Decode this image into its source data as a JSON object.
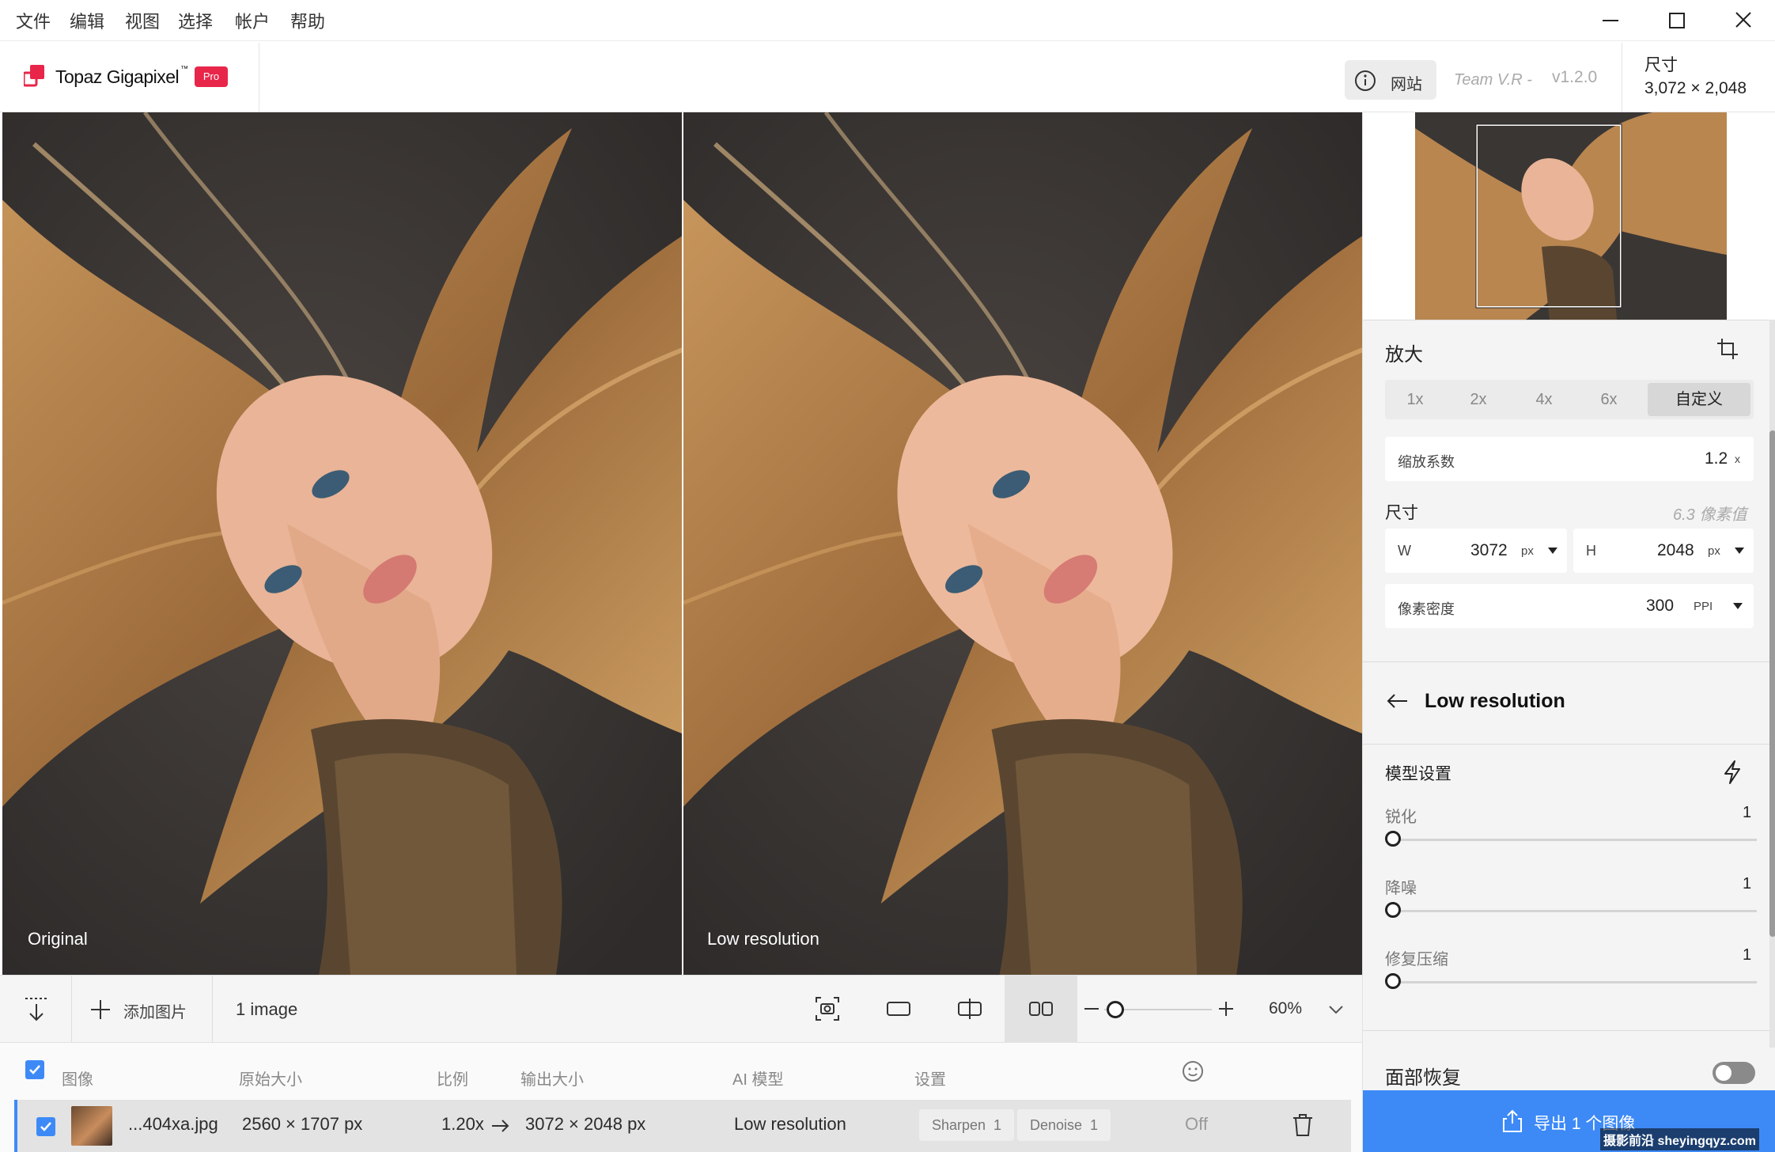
{
  "menu": [
    "文件",
    "编辑",
    "视图",
    "选择",
    "帐户",
    "帮助"
  ],
  "header": {
    "app_name": "Topaz Gigapixel",
    "app_tm": "™",
    "pro_badge": "Pro",
    "website_label": "网站",
    "team": "Team V.R -",
    "version": "v1.2.0",
    "size_label": "尺寸",
    "size_value": "3,072 × 2,048"
  },
  "viewer": {
    "left_label": "Original",
    "right_label": "Low resolution"
  },
  "toolbar": {
    "add_image": "添加图片",
    "image_count": "1 image",
    "zoom": "60%",
    "zoom_level_fraction": 0.1
  },
  "table": {
    "headers": {
      "image": "图像",
      "original_size": "原始大小",
      "ratio": "比例",
      "output_size": "输出大小",
      "ai_model": "AI 模型",
      "settings": "设置"
    },
    "rows": [
      {
        "filename": "...404xa.jpg",
        "original_size": "2560 × 1707 px",
        "ratio": "1.20x",
        "output_size": "3072 × 2048 px",
        "model": "Low resolution",
        "chips": [
          "Sharpen  1",
          "Denoise  1"
        ],
        "face": "Off"
      }
    ]
  },
  "panel": {
    "upscale_title": "放大",
    "scale_options": [
      "1x",
      "2x",
      "4x",
      "6x",
      "自定义"
    ],
    "scale_factor_label": "缩放系数",
    "scale_factor_value": "1.2",
    "scale_factor_unit": "x",
    "dimensions_label": "尺寸",
    "megapixels": "6.3 像素值",
    "w_label": "W",
    "w_value": "3072",
    "w_unit": "px",
    "h_label": "H",
    "h_value": "2048",
    "h_unit": "px",
    "ppi_label": "像素密度",
    "ppi_value": "300",
    "ppi_unit": "PPI",
    "model_name": "Low resolution",
    "model_settings": "模型设置",
    "sliders": [
      {
        "label": "锐化",
        "value": "1"
      },
      {
        "label": "降噪",
        "value": "1"
      },
      {
        "label": "修复压缩",
        "value": "1"
      }
    ],
    "face_recovery": "面部恢复",
    "export_label": "导出 1 个图像",
    "watermark": "摄影前沿 sheyingqyz.com"
  },
  "colors": {
    "accent": "#3d8af7",
    "pro_badge": "#e8264a",
    "export_bg": "#3d8af7"
  }
}
